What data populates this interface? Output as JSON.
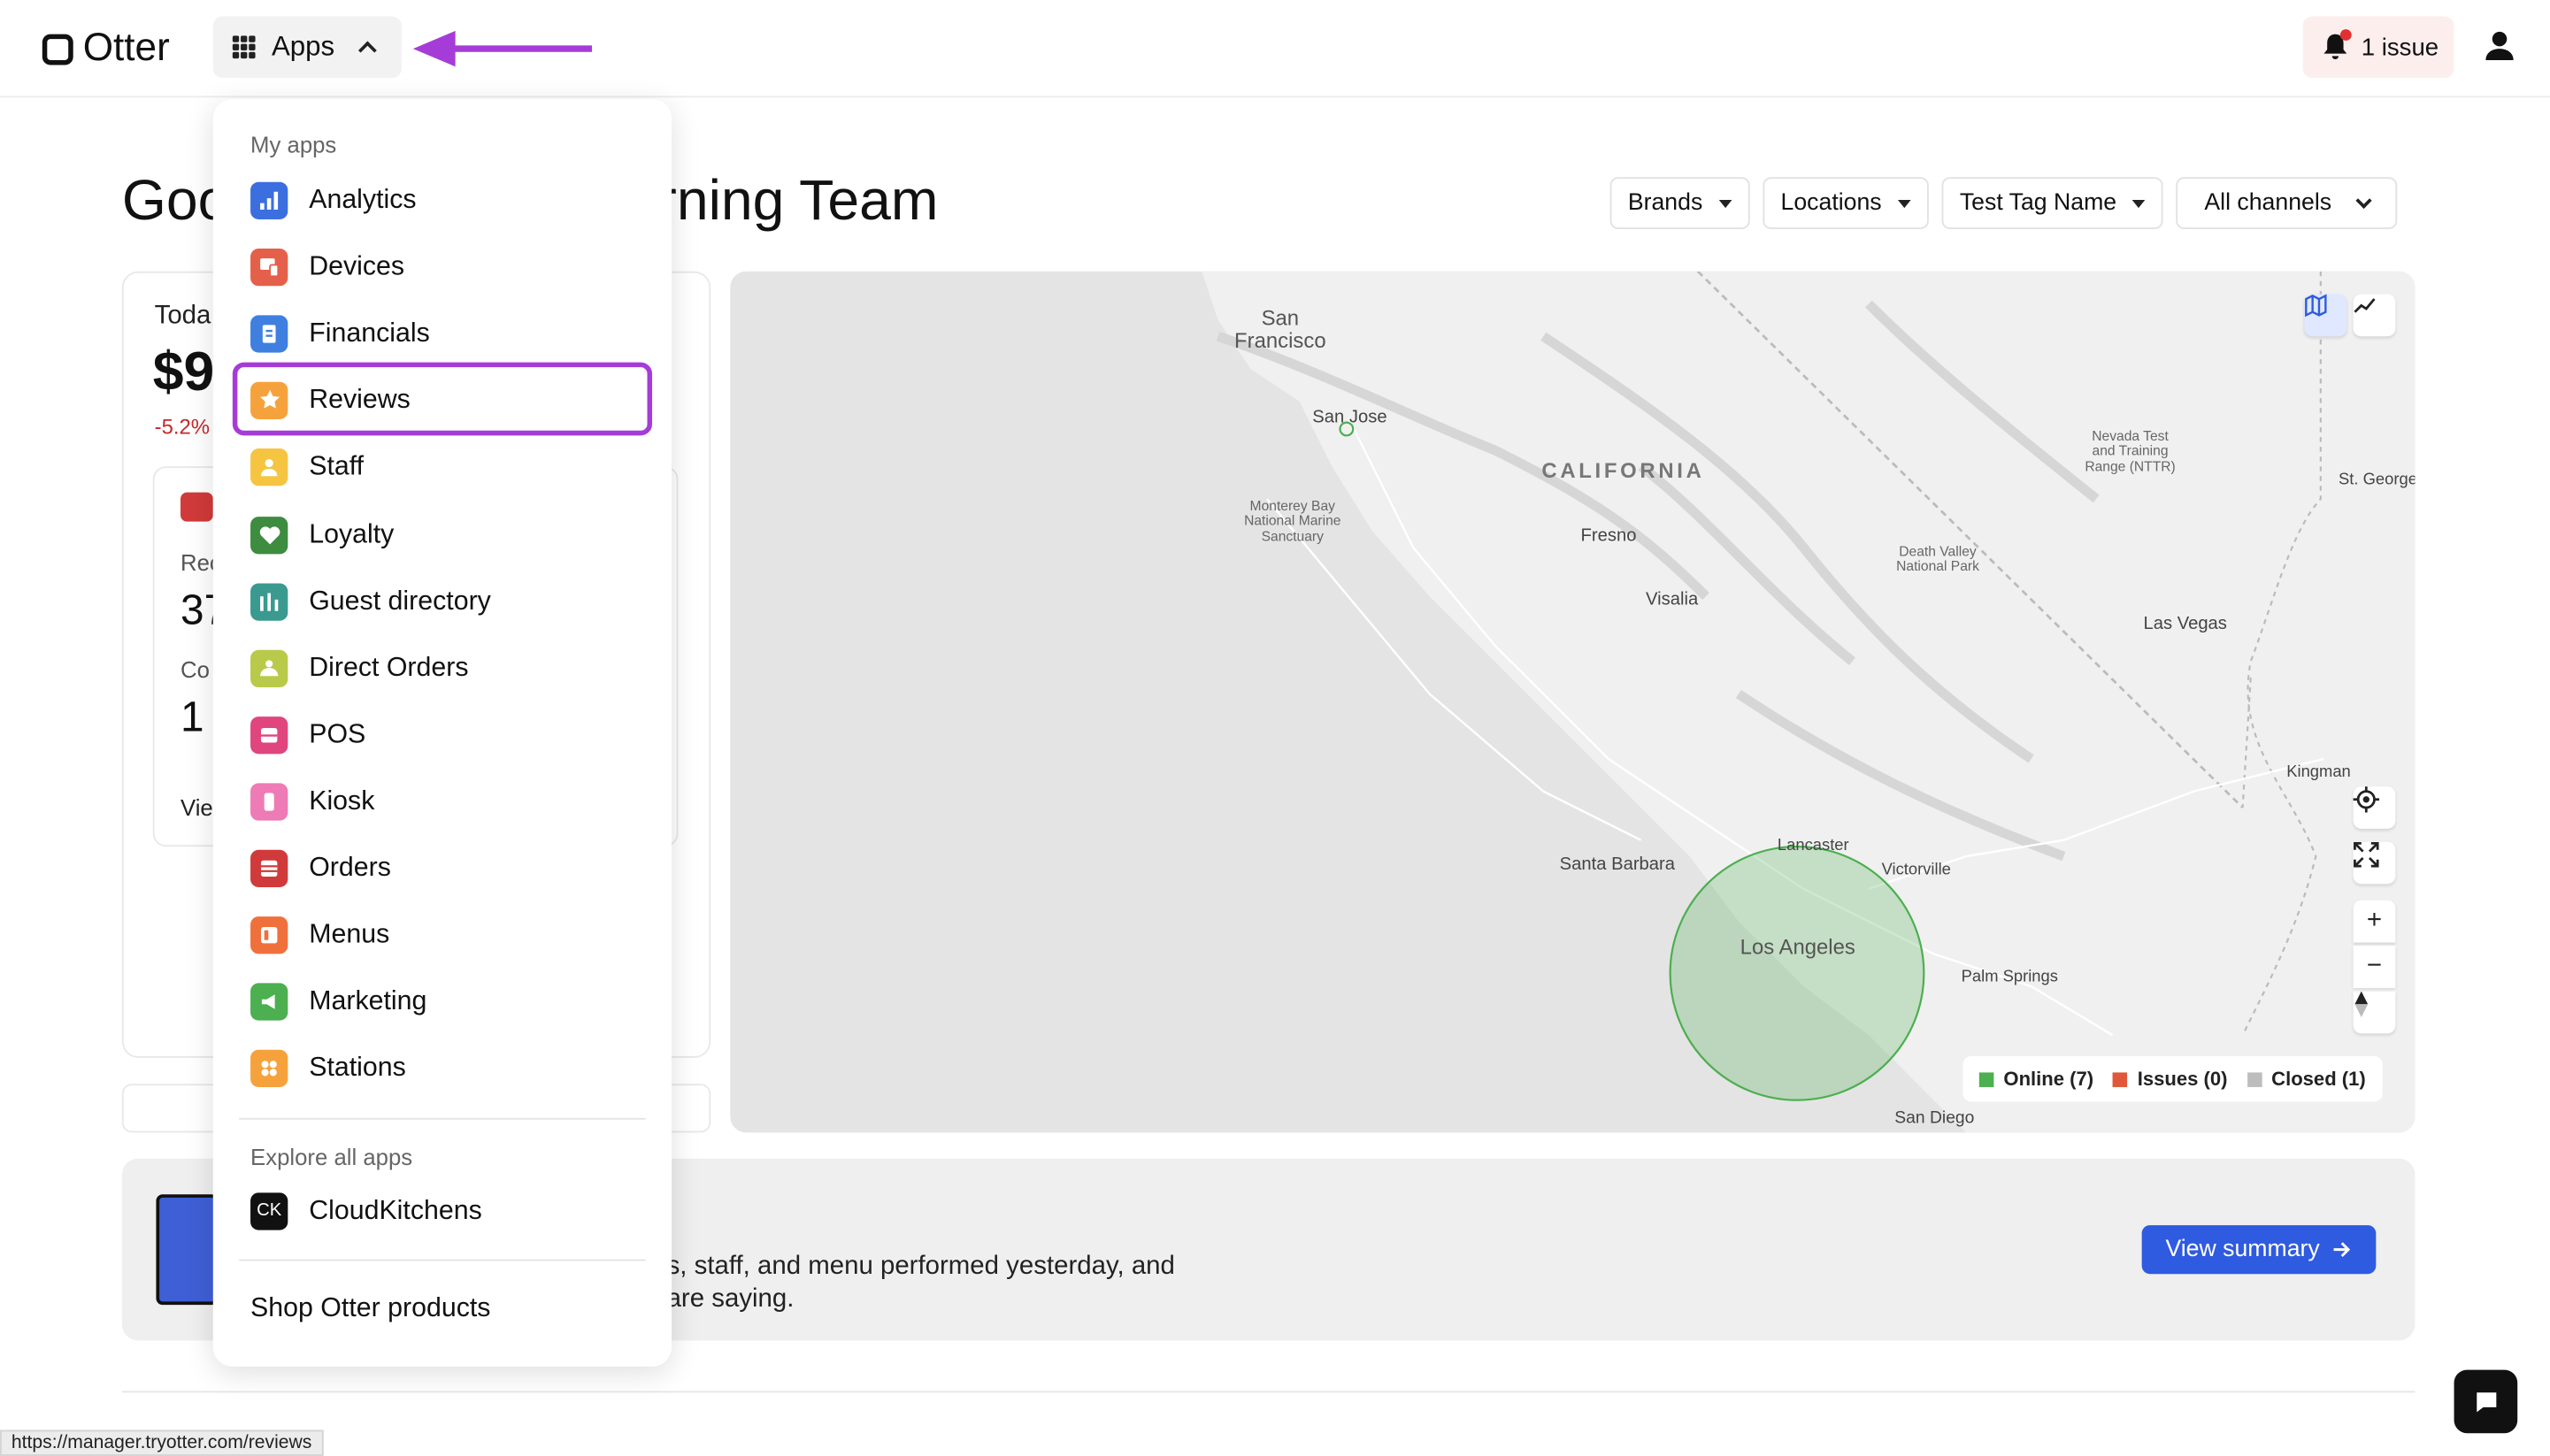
{
  "header": {
    "logo_text": "Otter",
    "apps_label": "Apps",
    "issue_label": "1 issue"
  },
  "greeting": {
    "part1": "Goo",
    "part2": "arning Team"
  },
  "filters": [
    {
      "label": "Brands"
    },
    {
      "label": "Locations"
    },
    {
      "label": "Test Tag Name"
    },
    {
      "label": "All channels"
    }
  ],
  "stat_card": {
    "today": "Toda",
    "amount": "$9",
    "change": "-5.2%",
    "rec_label": "Rec",
    "rec_value": "37",
    "com_label": "Co",
    "com_value": "1",
    "view": "Vie"
  },
  "apps_menu": {
    "my_apps_header": "My apps",
    "items": [
      {
        "label": "Analytics",
        "icon": "analytics-icon",
        "color": "#3b6fe0"
      },
      {
        "label": "Devices",
        "icon": "devices-icon",
        "color": "#e5604a"
      },
      {
        "label": "Financials",
        "icon": "financials-icon",
        "color": "#3f7fe0"
      },
      {
        "label": "Reviews",
        "icon": "star-icon",
        "color": "#f6a23c"
      },
      {
        "label": "Staff",
        "icon": "staff-icon",
        "color": "#f5c542"
      },
      {
        "label": "Loyalty",
        "icon": "heart-icon",
        "color": "#3d8c3f"
      },
      {
        "label": "Guest directory",
        "icon": "guest-directory-icon",
        "color": "#3a9a8f"
      },
      {
        "label": "Direct Orders",
        "icon": "direct-orders-icon",
        "color": "#b9c94a"
      },
      {
        "label": "POS",
        "icon": "pos-icon",
        "color": "#e0457e"
      },
      {
        "label": "Kiosk",
        "icon": "kiosk-icon",
        "color": "#ee7bb5"
      },
      {
        "label": "Orders",
        "icon": "orders-icon",
        "color": "#d13a3a"
      },
      {
        "label": "Menus",
        "icon": "menus-icon",
        "color": "#f0703c"
      },
      {
        "label": "Marketing",
        "icon": "marketing-icon",
        "color": "#4caf50"
      },
      {
        "label": "Stations",
        "icon": "stations-icon",
        "color": "#f6a23c"
      }
    ],
    "explore_header": "Explore all apps",
    "explore_items": [
      {
        "label": "CloudKitchens",
        "icon_text": "CK"
      }
    ],
    "shop_label": "Shop Otter products"
  },
  "map": {
    "labels": {
      "san_francisco": "San\nFrancisco",
      "san_jose": "San Jose",
      "california": "CALIFORNIA",
      "monterey": "Monterey Bay\nNational Marine\nSanctuary",
      "fresno": "Fresno",
      "visalia": "Visalia",
      "nevada_test": "Nevada Test\nand Training\nRange (NTTR)",
      "st_george": "St. George",
      "death_valley": "Death Valley\nNational Park",
      "las_vegas": "Las Vegas",
      "kingman": "Kingman",
      "lancaster": "Lancaster",
      "victorville": "Victorville",
      "santa_barbara": "Santa Barbara",
      "los_angeles": "Los Angeles",
      "palm_springs": "Palm Springs",
      "san_diego": "San Diego"
    },
    "legend": [
      {
        "label": "Online (7)",
        "color": "#4caf50"
      },
      {
        "label": "Issues (0)",
        "color": "#e0573a"
      },
      {
        "label": "Closed (1)",
        "color": "#bdbdbd"
      }
    ]
  },
  "banner": {
    "line1": "s, staff, and menu performed yesterday, and",
    "line2": "are saying.",
    "cta": "View summary"
  },
  "status_url": "https://manager.tryotter.com/reviews",
  "colors": {
    "annotation_purple": "#a63cd8",
    "primary_blue": "#2f5be0"
  }
}
